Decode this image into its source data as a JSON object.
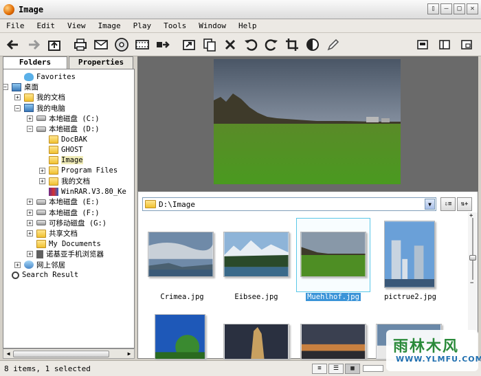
{
  "window": {
    "title": "Image",
    "buttons": [
      "▯",
      "—",
      "□",
      "✕"
    ]
  },
  "menu": [
    "File",
    "Edit",
    "View",
    "Image",
    "Play",
    "Tools",
    "Window",
    "Help"
  ],
  "toolbar": {
    "left": [
      "back-arrow-icon",
      "forward-arrow-icon",
      "up-folder-icon",
      "print-icon",
      "email-icon",
      "cd-icon",
      "filmstrip-icon",
      "batch-icon",
      "move-to-icon",
      "copy-to-icon",
      "delete-icon",
      "rotate-left-icon",
      "rotate-right-icon",
      "crop-icon",
      "adjust-icon",
      "pencil-icon"
    ],
    "right": [
      "fullscreen-icon",
      "panel-icon",
      "layout-icon"
    ]
  },
  "left_tabs": {
    "folders": "Folders",
    "properties": "Properties"
  },
  "tree": [
    {
      "label": "Favorites",
      "level": 1,
      "icon": "heart-icon"
    },
    {
      "label": "桌面",
      "level": 0,
      "icon": "desktop-icon",
      "expander": "−"
    },
    {
      "label": "我的文档",
      "level": 1,
      "icon": "folder-icon",
      "expander": "+"
    },
    {
      "label": "我的电脑",
      "level": 1,
      "icon": "computer-icon",
      "expander": "−"
    },
    {
      "label": "本地磁盘 (C:)",
      "level": 2,
      "icon": "drive-icon",
      "expander": "+"
    },
    {
      "label": "本地磁盘 (D:)",
      "level": 2,
      "icon": "drive-icon",
      "expander": "−"
    },
    {
      "label": "DocBAK",
      "level": 3,
      "icon": "folder-icon"
    },
    {
      "label": "GHOST",
      "level": 3,
      "icon": "folder-icon"
    },
    {
      "label": "Image",
      "level": 3,
      "icon": "folder-open-icon",
      "selected": true
    },
    {
      "label": "Program Files",
      "level": 3,
      "icon": "folder-icon",
      "expander": "+"
    },
    {
      "label": "我的文档",
      "level": 3,
      "icon": "folder-icon",
      "expander": "+"
    },
    {
      "label": "WinRAR.V3.80_Ke",
      "level": 3,
      "icon": "winrar-icon"
    },
    {
      "label": "本地磁盘 (E:)",
      "level": 2,
      "icon": "drive-icon",
      "expander": "+"
    },
    {
      "label": "本地磁盘 (F:)",
      "level": 2,
      "icon": "drive-icon",
      "expander": "+"
    },
    {
      "label": "可移动磁盘 (G:)",
      "level": 2,
      "icon": "drive-icon",
      "expander": "+"
    },
    {
      "label": "共享文档",
      "level": 2,
      "icon": "folder-icon",
      "expander": "+"
    },
    {
      "label": "My Documents",
      "level": 2,
      "icon": "folder-icon"
    },
    {
      "label": "诺基亚手机浏览器",
      "level": 2,
      "icon": "phone-icon",
      "expander": "+"
    },
    {
      "label": "网上邻居",
      "level": 1,
      "icon": "network-icon",
      "expander": "+"
    },
    {
      "label": "Search Result",
      "level": 0,
      "icon": "search-icon"
    }
  ],
  "path": {
    "value": "D:\\Image"
  },
  "thumbnails": [
    {
      "name": "Crimea.jpg",
      "selected": false
    },
    {
      "name": "Eibsee.jpg",
      "selected": false
    },
    {
      "name": "Muehlhof.jpg",
      "selected": true
    },
    {
      "name": "pictrue2.jpg",
      "selected": false
    }
  ],
  "status": {
    "text": "8 items, 1 selected"
  },
  "watermark": {
    "line1": "雨林木风",
    "line2": "WWW.YLMFU.COM"
  }
}
